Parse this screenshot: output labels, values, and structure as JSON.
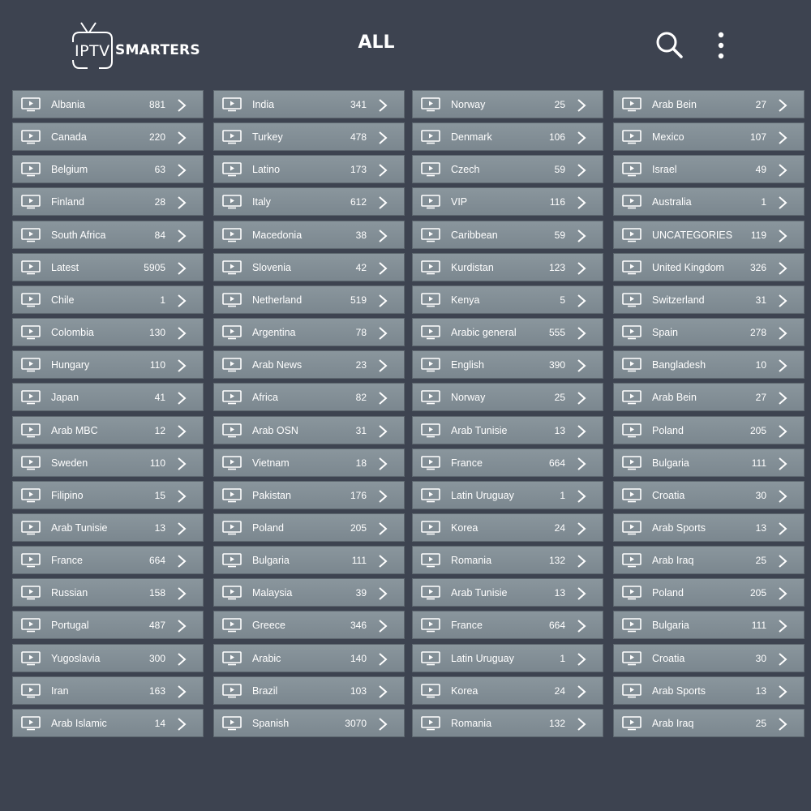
{
  "header": {
    "logo_iptv": "IPTV",
    "logo_smarters": "SMARTERS",
    "title": "ALL"
  },
  "icons": {
    "category": "tv-icon",
    "open": "chevron-right-icon",
    "search": "search-icon",
    "more": "more-vertical-icon"
  },
  "columns": [
    {
      "items": [
        {
          "name": "Albania",
          "count": "881"
        },
        {
          "name": "Canada",
          "count": "220"
        },
        {
          "name": "Belgium",
          "count": "63"
        },
        {
          "name": "Finland",
          "count": "28"
        },
        {
          "name": "South Africa",
          "count": "84"
        },
        {
          "name": "Latest",
          "count": "5905"
        },
        {
          "name": "Chile",
          "count": "1"
        },
        {
          "name": "Colombia",
          "count": "130"
        },
        {
          "name": "Hungary",
          "count": "110"
        },
        {
          "name": "Japan",
          "count": "41"
        },
        {
          "name": "Arab MBC",
          "count": "12"
        },
        {
          "name": "Sweden",
          "count": "110"
        },
        {
          "name": "Filipino",
          "count": "15"
        },
        {
          "name": "Arab Tunisie",
          "count": "13"
        },
        {
          "name": "France",
          "count": "664"
        },
        {
          "name": "Russian",
          "count": "158"
        },
        {
          "name": "Portugal",
          "count": "487"
        },
        {
          "name": "Yugoslavia",
          "count": "300"
        },
        {
          "name": "Iran",
          "count": "163"
        },
        {
          "name": "Arab Islamic",
          "count": "14"
        }
      ]
    },
    {
      "items": [
        {
          "name": "India",
          "count": "341"
        },
        {
          "name": "Turkey",
          "count": "478"
        },
        {
          "name": "Latino",
          "count": "173"
        },
        {
          "name": "Italy",
          "count": "612"
        },
        {
          "name": "Macedonia",
          "count": "38"
        },
        {
          "name": "Slovenia",
          "count": "42"
        },
        {
          "name": "Netherland",
          "count": "519"
        },
        {
          "name": "Argentina",
          "count": "78"
        },
        {
          "name": "Arab News",
          "count": "23"
        },
        {
          "name": "Africa",
          "count": "82"
        },
        {
          "name": "Arab OSN",
          "count": "31"
        },
        {
          "name": "Vietnam",
          "count": "18"
        },
        {
          "name": "Pakistan",
          "count": "176"
        },
        {
          "name": "Poland",
          "count": "205"
        },
        {
          "name": "Bulgaria",
          "count": "111"
        },
        {
          "name": "Malaysia",
          "count": "39"
        },
        {
          "name": "Greece",
          "count": "346"
        },
        {
          "name": "Arabic",
          "count": "140"
        },
        {
          "name": "Brazil",
          "count": "103"
        },
        {
          "name": "Spanish",
          "count": "3070"
        }
      ]
    },
    {
      "items": [
        {
          "name": "Norway",
          "count": "25"
        },
        {
          "name": "Denmark",
          "count": "106"
        },
        {
          "name": "Czech",
          "count": "59"
        },
        {
          "name": "VIP",
          "count": "116"
        },
        {
          "name": "Caribbean",
          "count": "59"
        },
        {
          "name": "Kurdistan",
          "count": "123"
        },
        {
          "name": "Kenya",
          "count": "5"
        },
        {
          "name": "Arabic general",
          "count": "555"
        },
        {
          "name": "English",
          "count": "390"
        },
        {
          "name": "Norway",
          "count": "25"
        },
        {
          "name": "Arab Tunisie",
          "count": "13"
        },
        {
          "name": "France",
          "count": "664"
        },
        {
          "name": "Latin Uruguay",
          "count": "1"
        },
        {
          "name": "Korea",
          "count": "24"
        },
        {
          "name": "Romania",
          "count": "132"
        },
        {
          "name": "Arab Tunisie",
          "count": "13"
        },
        {
          "name": "France",
          "count": "664"
        },
        {
          "name": "Latin Uruguay",
          "count": "1"
        },
        {
          "name": "Korea",
          "count": "24"
        },
        {
          "name": "Romania",
          "count": "132"
        }
      ]
    },
    {
      "items": [
        {
          "name": "Arab Bein",
          "count": "27"
        },
        {
          "name": "Mexico",
          "count": "107"
        },
        {
          "name": "Israel",
          "count": "49"
        },
        {
          "name": "Australia",
          "count": "1"
        },
        {
          "name": "UNCATEGORIES",
          "count": "119"
        },
        {
          "name": "United Kingdom",
          "count": "326"
        },
        {
          "name": "Switzerland",
          "count": "31"
        },
        {
          "name": "Spain",
          "count": "278"
        },
        {
          "name": "Bangladesh",
          "count": "10"
        },
        {
          "name": "Arab Bein",
          "count": "27"
        },
        {
          "name": "Poland",
          "count": "205"
        },
        {
          "name": "Bulgaria",
          "count": "111"
        },
        {
          "name": "Croatia",
          "count": "30"
        },
        {
          "name": "Arab Sports",
          "count": "13"
        },
        {
          "name": "Arab Iraq",
          "count": "25"
        },
        {
          "name": "Poland",
          "count": "205"
        },
        {
          "name": "Bulgaria",
          "count": "111"
        },
        {
          "name": "Croatia",
          "count": "30"
        },
        {
          "name": "Arab Sports",
          "count": "13"
        },
        {
          "name": "Arab Iraq",
          "count": "25"
        }
      ]
    }
  ]
}
